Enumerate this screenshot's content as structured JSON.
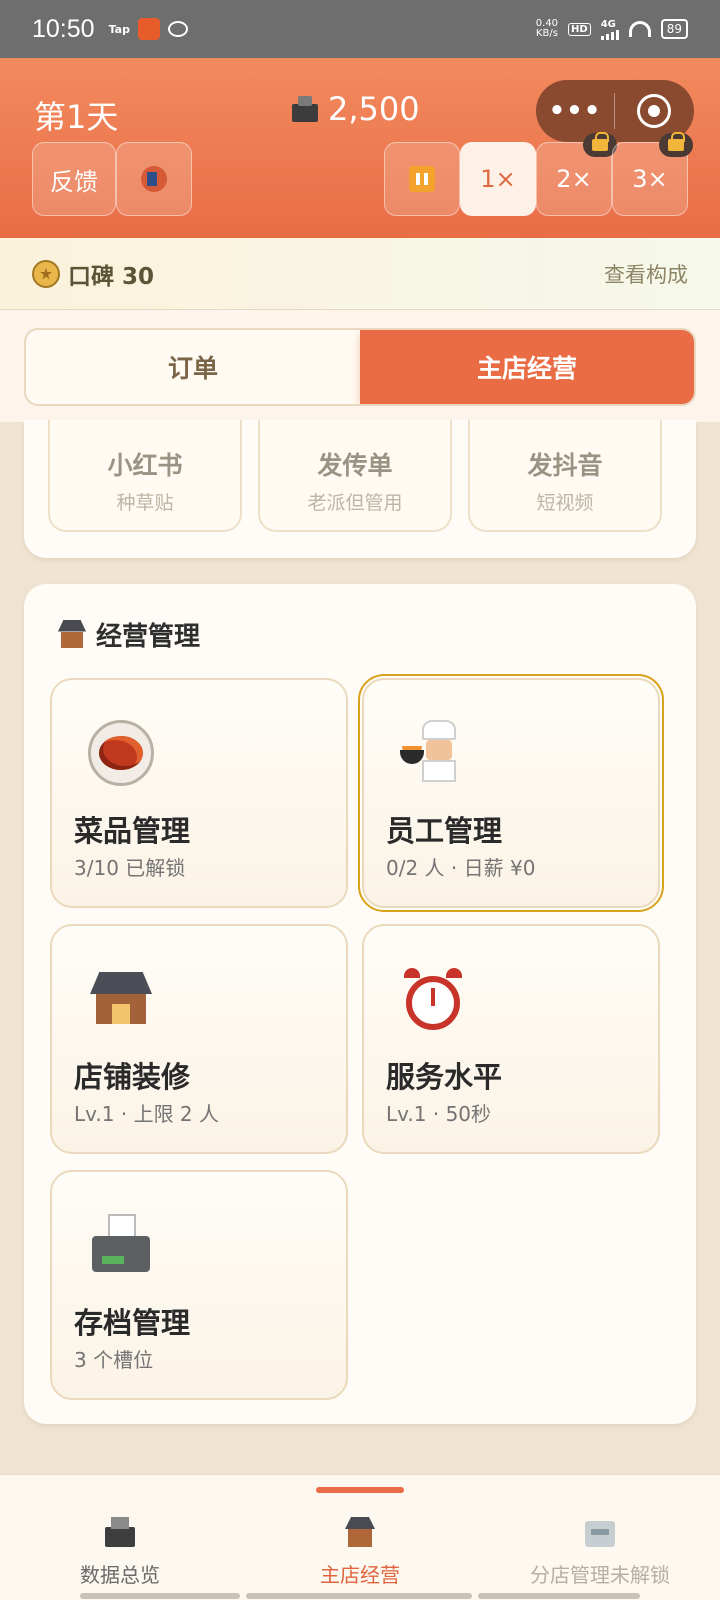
{
  "status_bar": {
    "time": "10:50",
    "apps": [
      "Tap",
      "app-icon",
      "wechat-icon"
    ],
    "net_speed_value": "0.40",
    "net_speed_unit": "KB/s",
    "hd": "HD",
    "network": "4G",
    "battery": "89"
  },
  "header": {
    "day": "第1天",
    "money": "2,500",
    "capsule_more": "•••",
    "feedback_label": "反馈",
    "speeds": [
      "1×",
      "2×",
      "3×"
    ],
    "active_speed": "1×",
    "locked_speeds": [
      "2×",
      "3×"
    ]
  },
  "reputation": {
    "label": "口碑 30",
    "link": "查看构成"
  },
  "tabs": [
    {
      "label": "订单",
      "active": false
    },
    {
      "label": "主店经营",
      "active": true
    }
  ],
  "promo": [
    {
      "title": "小红书",
      "subtitle": "种草贴"
    },
    {
      "title": "发传单",
      "subtitle": "老派但管用"
    },
    {
      "title": "发抖音",
      "subtitle": "短视频"
    }
  ],
  "management": {
    "title": "经营管理",
    "tiles": [
      {
        "name": "菜品管理",
        "sub": "3/10 已解锁",
        "icon": "dish-icon"
      },
      {
        "name": "员工管理",
        "sub": "0/2 人 · 日薪 ¥0",
        "icon": "chef-icon",
        "selected": true
      },
      {
        "name": "店铺装修",
        "sub": "Lv.1 · 上限 2 人",
        "icon": "shop-icon"
      },
      {
        "name": "服务水平",
        "sub": "Lv.1 · 50秒",
        "icon": "alarm-clock-icon"
      },
      {
        "name": "存档管理",
        "sub": "3 个槽位",
        "icon": "printer-icon"
      }
    ]
  },
  "bottom_nav": [
    {
      "label": "数据总览",
      "icon": "cash-register-icon",
      "state": "normal"
    },
    {
      "label": "主店经营",
      "icon": "shop-icon",
      "state": "active"
    },
    {
      "label": "分店管理未解锁",
      "icon": "branch-building-icon",
      "state": "disabled"
    }
  ],
  "colors": {
    "accent": "#e96c44",
    "header_top": "#f38a5e",
    "selection": "#d9a21b"
  }
}
